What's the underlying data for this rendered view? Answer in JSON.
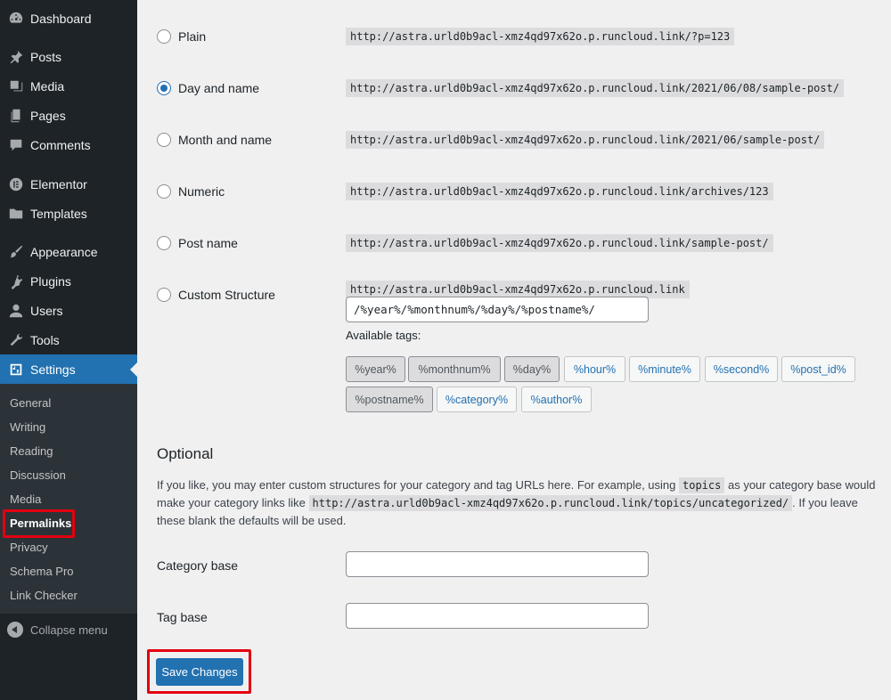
{
  "sidebar": {
    "menu": [
      {
        "label": "Dashboard",
        "icon": "dashboard-icon"
      },
      {
        "label": "Posts",
        "icon": "pin-icon"
      },
      {
        "label": "Media",
        "icon": "media-icon"
      },
      {
        "label": "Pages",
        "icon": "pages-icon"
      },
      {
        "label": "Comments",
        "icon": "comment-icon"
      },
      {
        "label": "Elementor",
        "icon": "elementor-icon"
      },
      {
        "label": "Templates",
        "icon": "folder-icon"
      },
      {
        "label": "Appearance",
        "icon": "brush-icon"
      },
      {
        "label": "Plugins",
        "icon": "plugin-icon"
      },
      {
        "label": "Users",
        "icon": "user-icon"
      },
      {
        "label": "Tools",
        "icon": "wrench-icon"
      },
      {
        "label": "Settings",
        "icon": "settings-icon"
      }
    ],
    "submenu": [
      "General",
      "Writing",
      "Reading",
      "Discussion",
      "Media",
      "Permalinks",
      "Privacy",
      "Schema Pro",
      "Link Checker"
    ],
    "current_submenu": "Permalinks",
    "collapse_label": "Collapse menu"
  },
  "permalinks": {
    "options": [
      {
        "label": "Plain",
        "example": "http://astra.urld0b9acl-xmz4qd97x62o.p.runcloud.link/?p=123",
        "checked": false
      },
      {
        "label": "Day and name",
        "example": "http://astra.urld0b9acl-xmz4qd97x62o.p.runcloud.link/2021/06/08/sample-post/",
        "checked": true
      },
      {
        "label": "Month and name",
        "example": "http://astra.urld0b9acl-xmz4qd97x62o.p.runcloud.link/2021/06/sample-post/",
        "checked": false
      },
      {
        "label": "Numeric",
        "example": "http://astra.urld0b9acl-xmz4qd97x62o.p.runcloud.link/archives/123",
        "checked": false
      },
      {
        "label": "Post name",
        "example": "http://astra.urld0b9acl-xmz4qd97x62o.p.runcloud.link/sample-post/",
        "checked": false
      },
      {
        "label": "Custom Structure",
        "example": "http://astra.urld0b9acl-xmz4qd97x62o.p.runcloud.link",
        "checked": false
      }
    ],
    "custom_structure_value": "/%year%/%monthnum%/%day%/%postname%/",
    "available_tags_label": "Available tags:",
    "tags": [
      {
        "label": "%year%",
        "active": true
      },
      {
        "label": "%monthnum%",
        "active": true
      },
      {
        "label": "%day%",
        "active": true
      },
      {
        "label": "%hour%",
        "active": false
      },
      {
        "label": "%minute%",
        "active": false
      },
      {
        "label": "%second%",
        "active": false
      },
      {
        "label": "%post_id%",
        "active": false
      },
      {
        "label": "%postname%",
        "active": true
      },
      {
        "label": "%category%",
        "active": false
      },
      {
        "label": "%author%",
        "active": false
      }
    ]
  },
  "optional": {
    "heading": "Optional",
    "desc_1": "If you like, you may enter custom structures for your category and tag URLs here. For example, using",
    "desc_code_1": "topics",
    "desc_2": "as your category base would make your category links like",
    "desc_code_2": "http://astra.urld0b9acl-xmz4qd97x62o.p.runcloud.link/topics/uncategorized/",
    "desc_3": ". If you leave these blank the defaults will be used.",
    "category_base_label": "Category base",
    "category_base_value": "",
    "tag_base_label": "Tag base",
    "tag_base_value": ""
  },
  "save_label": "Save Changes",
  "colors": {
    "accent": "#2271b1",
    "sidebar_bg": "#1d2327",
    "highlight": "#e3000f"
  }
}
